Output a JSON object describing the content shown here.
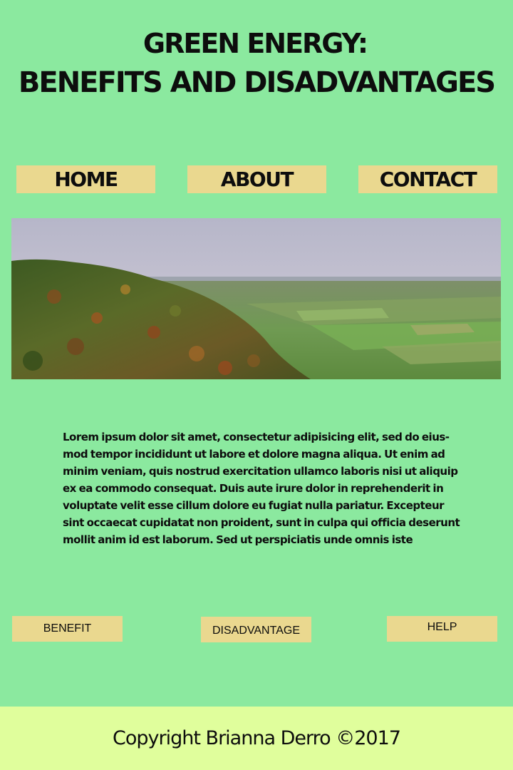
{
  "header": {
    "title_line1": "GREEN ENERGY:",
    "title_line2": "BENEFITS AND DISADVANTAGES"
  },
  "nav": {
    "home": "HOME",
    "about": "ABOUT",
    "contact": "CONTACT"
  },
  "hero": {
    "image": "landscape-photo"
  },
  "main": {
    "paragraph": "Lorem ipsum dolor sit amet, consectetur adipisicing elit, sed do eius-mod tempor incididunt ut labore et dolore magna aliqua. Ut enim ad minim veniam, quis nostrud exercitation ullamco laboris nisi ut aliquip ex ea commodo consequat. Duis aute irure dolor in reprehenderit in voluptate velit esse cillum dolore eu fugiat nulla pariatur. Excepteur sint occaecat cupidatat non proident, sunt in culpa qui officia deserunt mollit anim id est laborum. Sed ut perspiciatis unde omnis iste"
  },
  "subnav": {
    "benefit": "BENEFIT",
    "disadvantage": "DISADVANTAGE",
    "help": "HELP"
  },
  "footer": {
    "copyright": "Copyright Brianna Derro ©2017"
  },
  "colors": {
    "background": "#8be99f",
    "button": "#ead88f",
    "footer": "#e0fe9c",
    "text": "#0d0d0d"
  }
}
